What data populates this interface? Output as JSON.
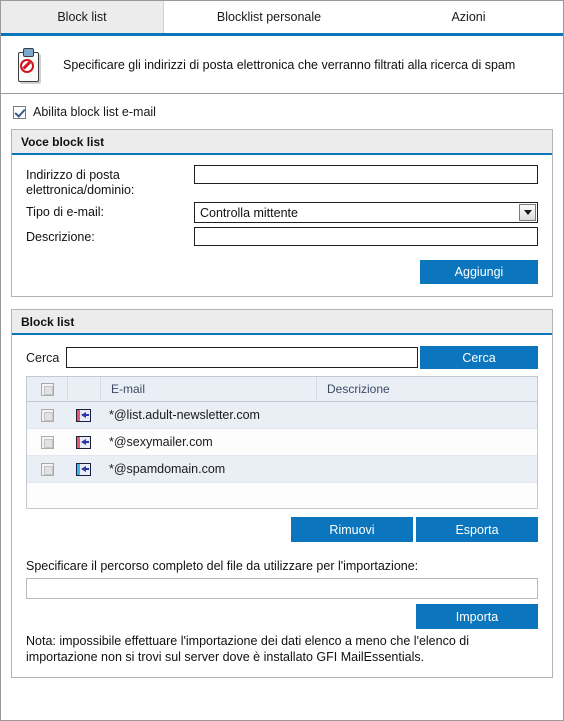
{
  "colors": {
    "accent": "#0b76bd",
    "tab_underline": "#0b75ba",
    "panel_header_bg": "#ececec",
    "row_alt_bg": "#eaeef5",
    "row_bg": "#fdfdfd",
    "header_text": "#3c4a66"
  },
  "tabs": [
    {
      "label": "Block list",
      "active": true
    },
    {
      "label": "Blocklist personale",
      "active": false
    },
    {
      "label": "Azioni",
      "active": false
    }
  ],
  "banner": {
    "icon": "clipboard-block-icon",
    "text": "Specificare gli indirizzi di posta elettronica che verranno filtrati alla ricerca di spam"
  },
  "enable": {
    "label": "Abilita block list e-mail",
    "checked": true
  },
  "entry_panel": {
    "title": "Voce block list",
    "fields": {
      "address_label": "Indirizzo di posta elettronica/dominio:",
      "address_value": "",
      "address_placeholder": "",
      "email_type_label": "Tipo di e-mail:",
      "email_type_value": "Controlla mittente",
      "email_type_options": [
        "Controlla mittente"
      ],
      "description_label": "Descrizione:",
      "description_value": "",
      "description_placeholder": ""
    },
    "add_button": "Aggiungi"
  },
  "list_panel": {
    "title": "Block list",
    "search_label": "Cerca",
    "search_value": "",
    "search_placeholder": "",
    "search_button": "Cerca",
    "columns": [
      "",
      "",
      "E-mail",
      "Descrizione"
    ],
    "select_all_checked": false,
    "rows": [
      {
        "checked": false,
        "icon": "block-sender-icon",
        "icon_bar_color": "#e05a6b",
        "email": "*@list.adult-newsletter.com",
        "description": ""
      },
      {
        "checked": false,
        "icon": "block-sender-icon",
        "icon_bar_color": "#e05a6b",
        "email": "*@sexymailer.com",
        "description": ""
      },
      {
        "checked": false,
        "icon": "block-domain-icon",
        "icon_bar_color": "#35b7e8",
        "email": "*@spamdomain.com",
        "description": ""
      }
    ],
    "remove_button": "Rimuovi",
    "export_button": "Esporta",
    "import_label": "Specificare il percorso completo del file da utilizzare per l'importazione:",
    "import_value": "",
    "import_placeholder": "",
    "import_button": "Importa",
    "note": "Nota: impossibile effettuare l'importazione dei dati elenco a meno che l'elenco di importazione non si trovi sul server dove è installato GFI MailEssentials."
  }
}
